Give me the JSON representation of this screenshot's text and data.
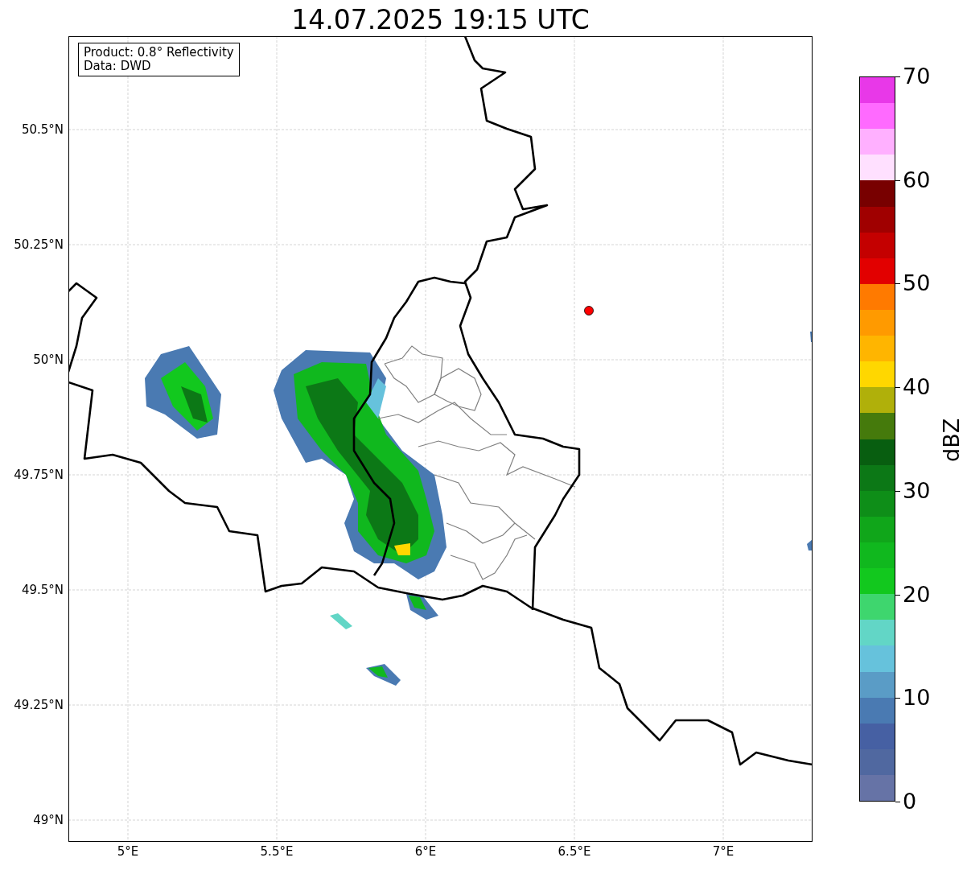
{
  "title": "14.07.2025 19:15 UTC",
  "info_box": [
    "Product: 0.8° Reflectivity",
    "Data: DWD"
  ],
  "map": {
    "x_ticks": [
      "5°E",
      "5.5°E",
      "6°E",
      "6.5°E",
      "7°E"
    ],
    "y_ticks": [
      "50.5°N",
      "50.25°N",
      "50°N",
      "49.75°N",
      "49.5°N",
      "49.25°N",
      "49°N"
    ]
  },
  "colorbar": {
    "label": "dBZ",
    "ticks": [
      "70",
      "60",
      "50",
      "40",
      "30",
      "20",
      "10",
      "0"
    ],
    "segments": [
      {
        "color": "#e838e8"
      },
      {
        "color": "#ff6aff"
      },
      {
        "color": "#ffb0ff"
      },
      {
        "color": "#ffe0ff"
      },
      {
        "color": "#780000"
      },
      {
        "color": "#a00000"
      },
      {
        "color": "#c40000"
      },
      {
        "color": "#e20000"
      },
      {
        "color": "#ff7a00"
      },
      {
        "color": "#ff9a00"
      },
      {
        "color": "#ffb500"
      },
      {
        "color": "#ffd700"
      },
      {
        "color": "#b0b00a"
      },
      {
        "color": "#457a0c"
      },
      {
        "color": "#085e10"
      },
      {
        "color": "#0c7816"
      },
      {
        "color": "#0e8e18"
      },
      {
        "color": "#10a61a"
      },
      {
        "color": "#10b81e"
      },
      {
        "color": "#12c81e"
      },
      {
        "color": "#3ed66e"
      },
      {
        "color": "#62d6c6"
      },
      {
        "color": "#66c2dc"
      },
      {
        "color": "#5a9cc6"
      },
      {
        "color": "#4a7ab2"
      },
      {
        "color": "#4660a3"
      },
      {
        "color": "#5068a0"
      },
      {
        "color": "#6673a6"
      }
    ]
  }
}
